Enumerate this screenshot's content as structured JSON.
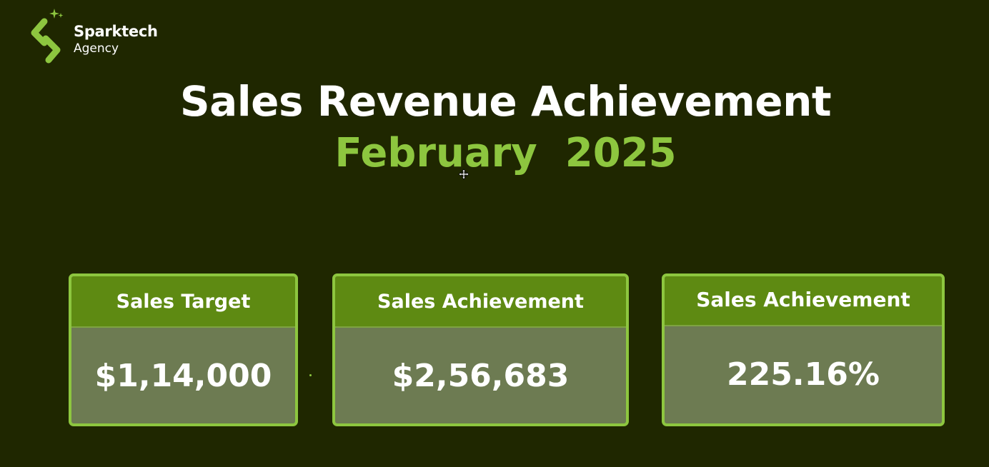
{
  "logo": {
    "name": "Sparktech",
    "subtitle": "Agency"
  },
  "heading": {
    "title": "Sales Revenue Achievement",
    "period": "February  2025"
  },
  "cards": [
    {
      "label": "Sales Target",
      "value": "$1,14,000"
    },
    {
      "label": "Sales Achievement",
      "value": "$2,56,683"
    },
    {
      "label": "Sales Achievement",
      "value": "225.16%"
    }
  ],
  "colors": {
    "background": "#1f2700",
    "accent": "#8dc63f",
    "card_header": "#5e8a12",
    "card_body": "#6d7b52"
  }
}
